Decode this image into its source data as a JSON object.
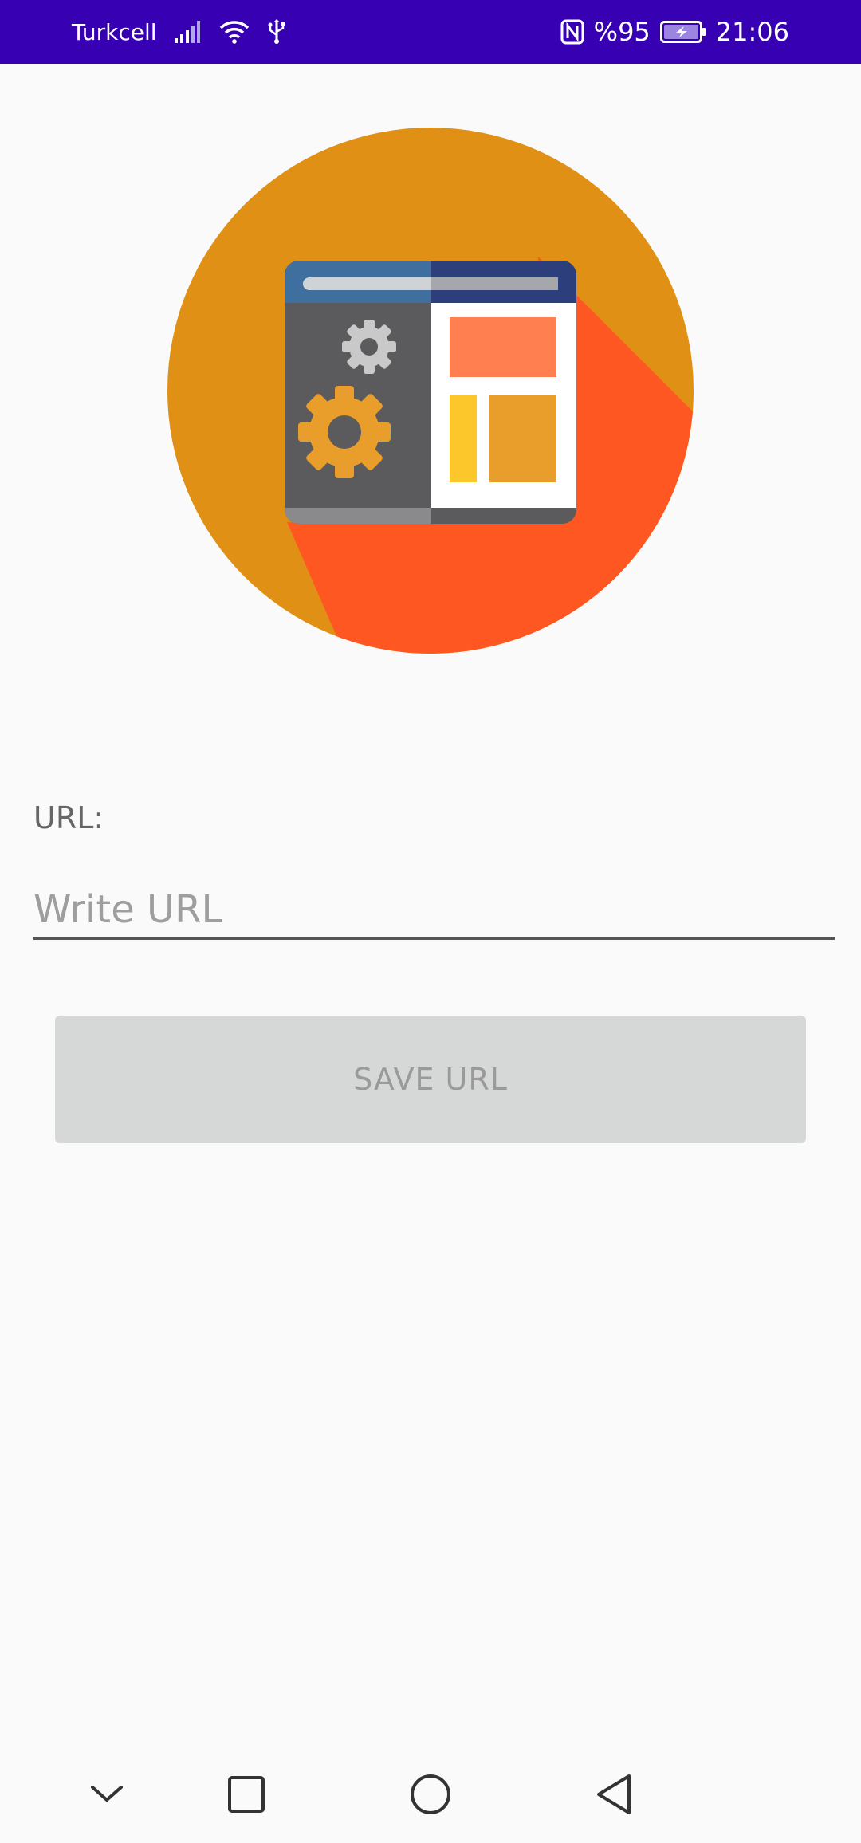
{
  "status_bar": {
    "carrier": "Turkcell",
    "battery": "%95",
    "time": "21:06",
    "icons": [
      "signal-icon",
      "wifi-icon",
      "usb-icon",
      "nfc-icon",
      "battery-charging-icon"
    ]
  },
  "logo": {
    "icon": "web-settings-icon",
    "colors": {
      "circle": "#e09115",
      "shadow": "#ff5722",
      "window_dark": "#5b5a5c",
      "title_bar_left": "#3f6f9e",
      "title_bar_right": "#2c3e7c",
      "gear_large": "#e99e2c",
      "gear_small": "#c9c9c9"
    }
  },
  "form": {
    "label": "URL:",
    "input_placeholder": "Write URL",
    "input_value": "",
    "save_button_label": "SAVE URL"
  },
  "nav_bar": {
    "buttons": [
      "chevron-down-icon",
      "recents-icon",
      "home-icon",
      "back-icon"
    ]
  },
  "theme": {
    "status_bar_color": "#3700b3",
    "background": "#fafafa",
    "button_disabled_bg": "#d6d7d7",
    "button_disabled_text": "#9a9a9a"
  }
}
